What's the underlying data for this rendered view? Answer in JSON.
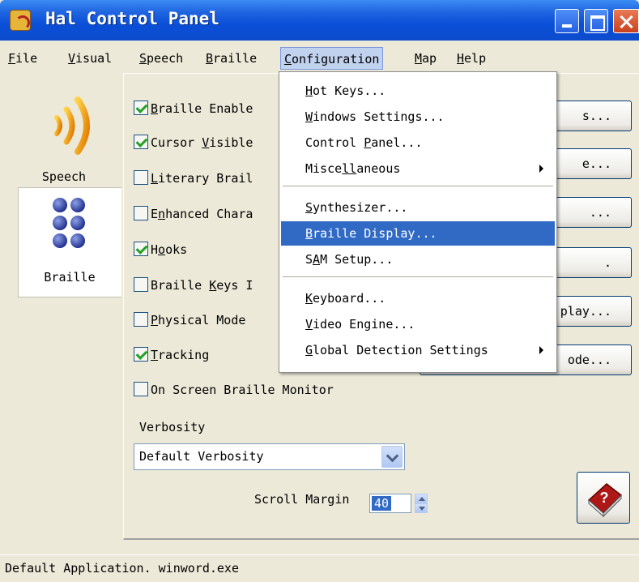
{
  "window": {
    "title": "Hal Control Panel"
  },
  "menubar": {
    "file": {
      "pre": "",
      "u": "F",
      "post": "ile"
    },
    "visual": {
      "pre": "",
      "u": "V",
      "post": "isual"
    },
    "speech": {
      "pre": "",
      "u": "S",
      "post": "peech"
    },
    "braille": {
      "pre": "",
      "u": "B",
      "post": "raille"
    },
    "configuration": {
      "pre": "",
      "u": "C",
      "post": "onfiguration"
    },
    "map": {
      "pre": "",
      "u": "M",
      "post": "ap"
    },
    "help": {
      "pre": "",
      "u": "H",
      "post": "elp"
    }
  },
  "sidebar": {
    "speech_label": "Speech",
    "braille_label": "Braille"
  },
  "options": [
    {
      "pre": "",
      "u": "B",
      "post": "raille Enable",
      "checked": true
    },
    {
      "pre": "Cursor ",
      "u": "V",
      "post": "isible",
      "checked": true
    },
    {
      "pre": "",
      "u": "L",
      "post": "iterary Brail",
      "checked": false
    },
    {
      "pre": "E",
      "u": "n",
      "post": "hanced Chara",
      "checked": false
    },
    {
      "pre": "H",
      "u": "o",
      "post": "oks",
      "checked": true
    },
    {
      "pre": "Braille ",
      "u": "K",
      "post": "eys I",
      "checked": false
    },
    {
      "pre": "",
      "u": "P",
      "post": "hysical Mode",
      "checked": false
    },
    {
      "pre": "",
      "u": "T",
      "post": "racking",
      "checked": true
    },
    {
      "pre": "On Screen Braille Monitor",
      "u": "",
      "post": "",
      "checked": false
    }
  ],
  "right_buttons": [
    "s...",
    "e...",
    "...",
    ".",
    "play...",
    "ode..."
  ],
  "verbosity": {
    "label": "Verbosity",
    "selected": "Default Verbosity"
  },
  "scroll_margin": {
    "label": "Scroll Margin",
    "value": "40"
  },
  "status": "Default Application. winword.exe",
  "configuration_menu": {
    "hot_keys": {
      "pre": "",
      "u": "H",
      "post": "ot Keys..."
    },
    "windows_settings": {
      "pre": "",
      "u": "W",
      "post": "indows Settings..."
    },
    "control_panel": {
      "pre": "Control ",
      "u": "P",
      "post": "anel..."
    },
    "miscellaneous": {
      "pre": "Misce",
      "u": "ll",
      "post": "aneous"
    },
    "synthesizer": {
      "pre": "",
      "u": "S",
      "post": "ynthesizer..."
    },
    "braille_display": {
      "pre": "",
      "u": "B",
      "post": "raille Display..."
    },
    "sam_setup": {
      "pre": "S",
      "u": "A",
      "post": "M Setup..."
    },
    "keyboard": {
      "pre": "",
      "u": "K",
      "post": "eyboard..."
    },
    "video_engine": {
      "pre": "",
      "u": "V",
      "post": "ideo Engine..."
    },
    "global_detection": {
      "pre": "",
      "u": "G",
      "post": "lobal Detection Settings"
    }
  },
  "colors": {
    "title_blue": "#0a4fd8",
    "highlight": "#316ac5",
    "face": "#ece9d8"
  }
}
